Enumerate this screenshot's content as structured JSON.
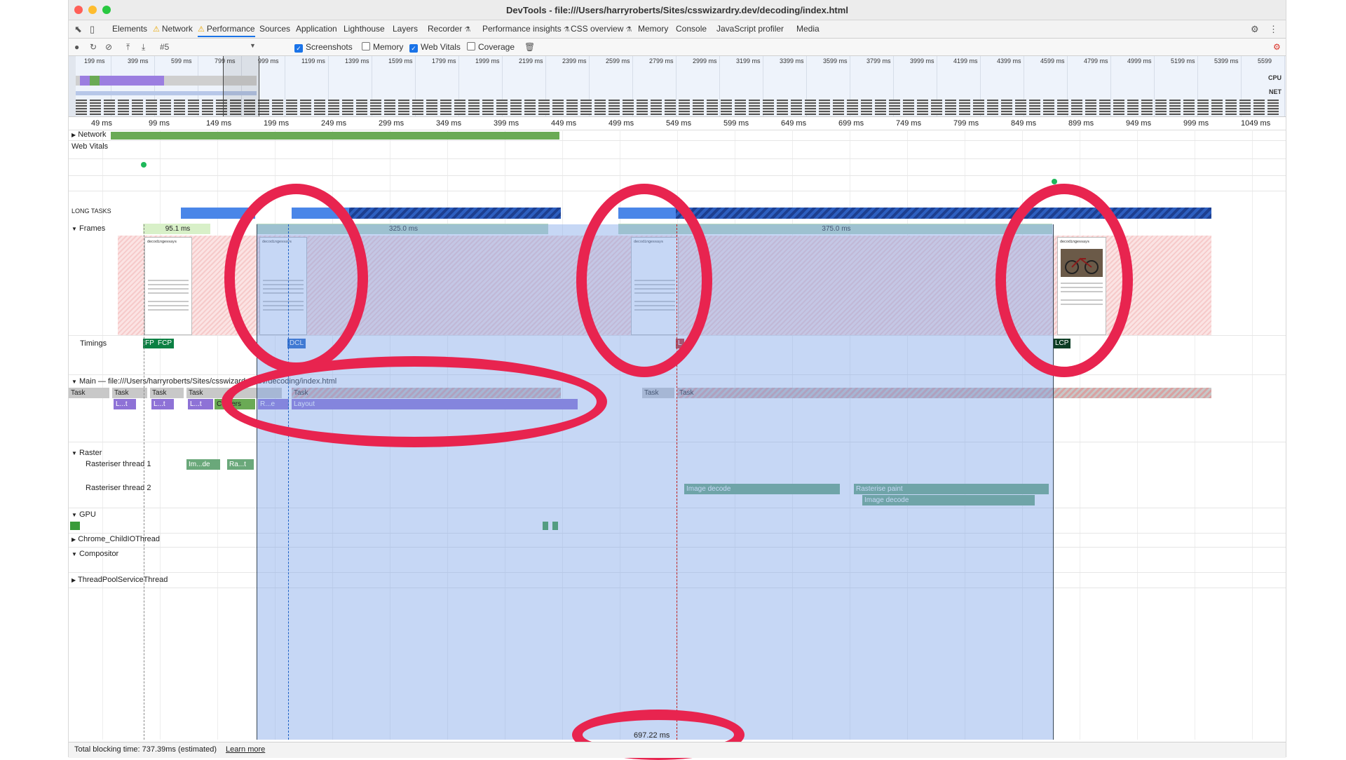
{
  "window": {
    "title": "DevTools - file:///Users/harryroberts/Sites/csswizardry.dev/decoding/index.html"
  },
  "tabs": [
    {
      "label": "Elements"
    },
    {
      "label": "Network",
      "warning": true
    },
    {
      "label": "Performance",
      "warning": true,
      "active": true
    },
    {
      "label": "Sources"
    },
    {
      "label": "Application"
    },
    {
      "label": "Lighthouse"
    },
    {
      "label": "Layers"
    },
    {
      "label": "Recorder",
      "flask": true
    },
    {
      "label": "Performance insights",
      "flask": true
    },
    {
      "label": "CSS overview",
      "flask": true
    },
    {
      "label": "Memory"
    },
    {
      "label": "Console"
    },
    {
      "label": "JavaScript profiler"
    },
    {
      "label": "Media"
    }
  ],
  "toolbar": {
    "profile_select": "#5",
    "screenshots_label": "Screenshots",
    "screenshots_checked": true,
    "memory_label": "Memory",
    "memory_checked": false,
    "web_vitals_label": "Web Vitals",
    "web_vitals_checked": true,
    "coverage_label": "Coverage",
    "coverage_checked": false
  },
  "overview": {
    "ticks": [
      "199 ms",
      "399 ms",
      "599 ms",
      "799 ms",
      "999 ms",
      "1199 ms",
      "1399 ms",
      "1599 ms",
      "1799 ms",
      "1999 ms",
      "2199 ms",
      "2399 ms",
      "2599 ms",
      "2799 ms",
      "2999 ms",
      "3199 ms",
      "3399 ms",
      "3599 ms",
      "3799 ms",
      "3999 ms",
      "4199 ms",
      "4399 ms",
      "4599 ms",
      "4799 ms",
      "4999 ms",
      "5199 ms",
      "5399 ms",
      "5599"
    ],
    "cpu_label": "CPU",
    "net_label": "NET"
  },
  "ruler": {
    "ticks": [
      "49 ms",
      "99 ms",
      "149 ms",
      "199 ms",
      "249 ms",
      "299 ms",
      "349 ms",
      "399 ms",
      "449 ms",
      "499 ms",
      "549 ms",
      "599 ms",
      "649 ms",
      "699 ms",
      "749 ms",
      "799 ms",
      "849 ms",
      "899 ms",
      "949 ms",
      "999 ms",
      "1049 ms"
    ]
  },
  "tracks": {
    "network": "Network",
    "web_vitals": "Web Vitals",
    "long_tasks": "LONG TASKS",
    "frames": "Frames",
    "frame_durations": [
      "95.1 ms",
      "325.0 ms",
      "375.0 ms"
    ],
    "timings": "Timings",
    "timing_markers": [
      "FP",
      "FCP",
      "DCL",
      "L",
      "LCP"
    ],
    "main": "Main — file:///Users/harryroberts/Sites/csswizardry.dev/decoding/index.html",
    "main_tasks": [
      "Task",
      "Task",
      "Task",
      "Task",
      "Task",
      "Task",
      "Task"
    ],
    "main_subtasks": [
      "L...t",
      "L...t",
      "L...t",
      "Co...ers",
      "R...e",
      "Layout"
    ],
    "raster": "Raster",
    "raster_thread_1": "Rasteriser thread 1",
    "raster_thread_1_bars": [
      "Im...de",
      "Ra...t"
    ],
    "raster_thread_2": "Rasteriser thread 2",
    "raster_thread_2_bars": [
      "Image decode",
      "Rasterise paint",
      "Image decode"
    ],
    "gpu": "GPU",
    "child_io": "Chrome_ChildIOThread",
    "compositor": "Compositor",
    "thread_pool": "ThreadPoolServiceThread"
  },
  "screenshot_heading": "decodingessays",
  "selection_duration": "697.22 ms",
  "status": {
    "text": "Total blocking time: 737.39ms (estimated)",
    "link": "Learn more"
  },
  "colors": {
    "annotation": "#e8244f",
    "selection": "#8fb0e8",
    "long_task": "#4a86e8",
    "network": "#6aaa55",
    "layout": "#8e72d6",
    "raster": "#6aa87a"
  }
}
